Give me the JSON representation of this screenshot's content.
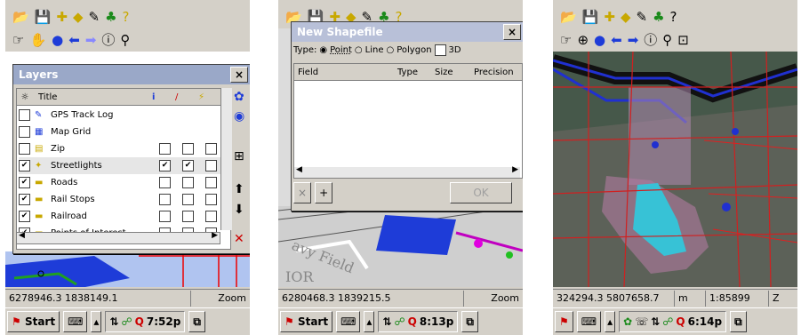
{
  "screen1": {
    "layers_title": "Layers",
    "close": "×",
    "columns": {
      "title": "Title",
      "info": "i",
      "edit": "/"
    },
    "layers": [
      {
        "name": "GPS Track Log",
        "checked": false,
        "cols": []
      },
      {
        "name": "Map Grid",
        "checked": false,
        "cols": []
      },
      {
        "name": "Zip",
        "checked": false,
        "cols": [
          false,
          false,
          false
        ]
      },
      {
        "name": "Streetlights",
        "checked": true,
        "cols": [
          true,
          true,
          false
        ]
      },
      {
        "name": "Roads",
        "checked": true,
        "cols": [
          false,
          false,
          false
        ]
      },
      {
        "name": "Rail Stops",
        "checked": true,
        "cols": [
          false,
          false,
          false
        ]
      },
      {
        "name": "Railroad",
        "checked": true,
        "cols": [
          false,
          false,
          false
        ]
      },
      {
        "name": "Points of Interest",
        "checked": true,
        "cols": [
          false,
          false,
          false
        ]
      }
    ],
    "status": {
      "coords": "6278946.3 1838149.1",
      "zoom": "Zoom"
    },
    "task": {
      "start": "Start",
      "time": "7:52p"
    }
  },
  "screen2": {
    "dialog_title": "New Shapefile",
    "close": "×",
    "type_label": "Type:",
    "types": [
      "Point",
      "Line",
      "Polygon"
    ],
    "extra": "3D",
    "selected_type": "Point",
    "columns": [
      "Field",
      "Type",
      "Size",
      "Precision"
    ],
    "delete": "×",
    "add": "+",
    "ok": "OK",
    "map_text": "avy Field",
    "map_text2": "IOR",
    "status": {
      "coords": "6280468.3 1839215.5",
      "zoom": "Zoom"
    },
    "task": {
      "start": "Start",
      "time": "8:13p"
    }
  },
  "screen3": {
    "status": {
      "coords": "324294.3 5807658.7",
      "unit": "m",
      "scale": "1:85899",
      "zoom": "Z"
    },
    "task": {
      "time": "6:14p"
    }
  }
}
